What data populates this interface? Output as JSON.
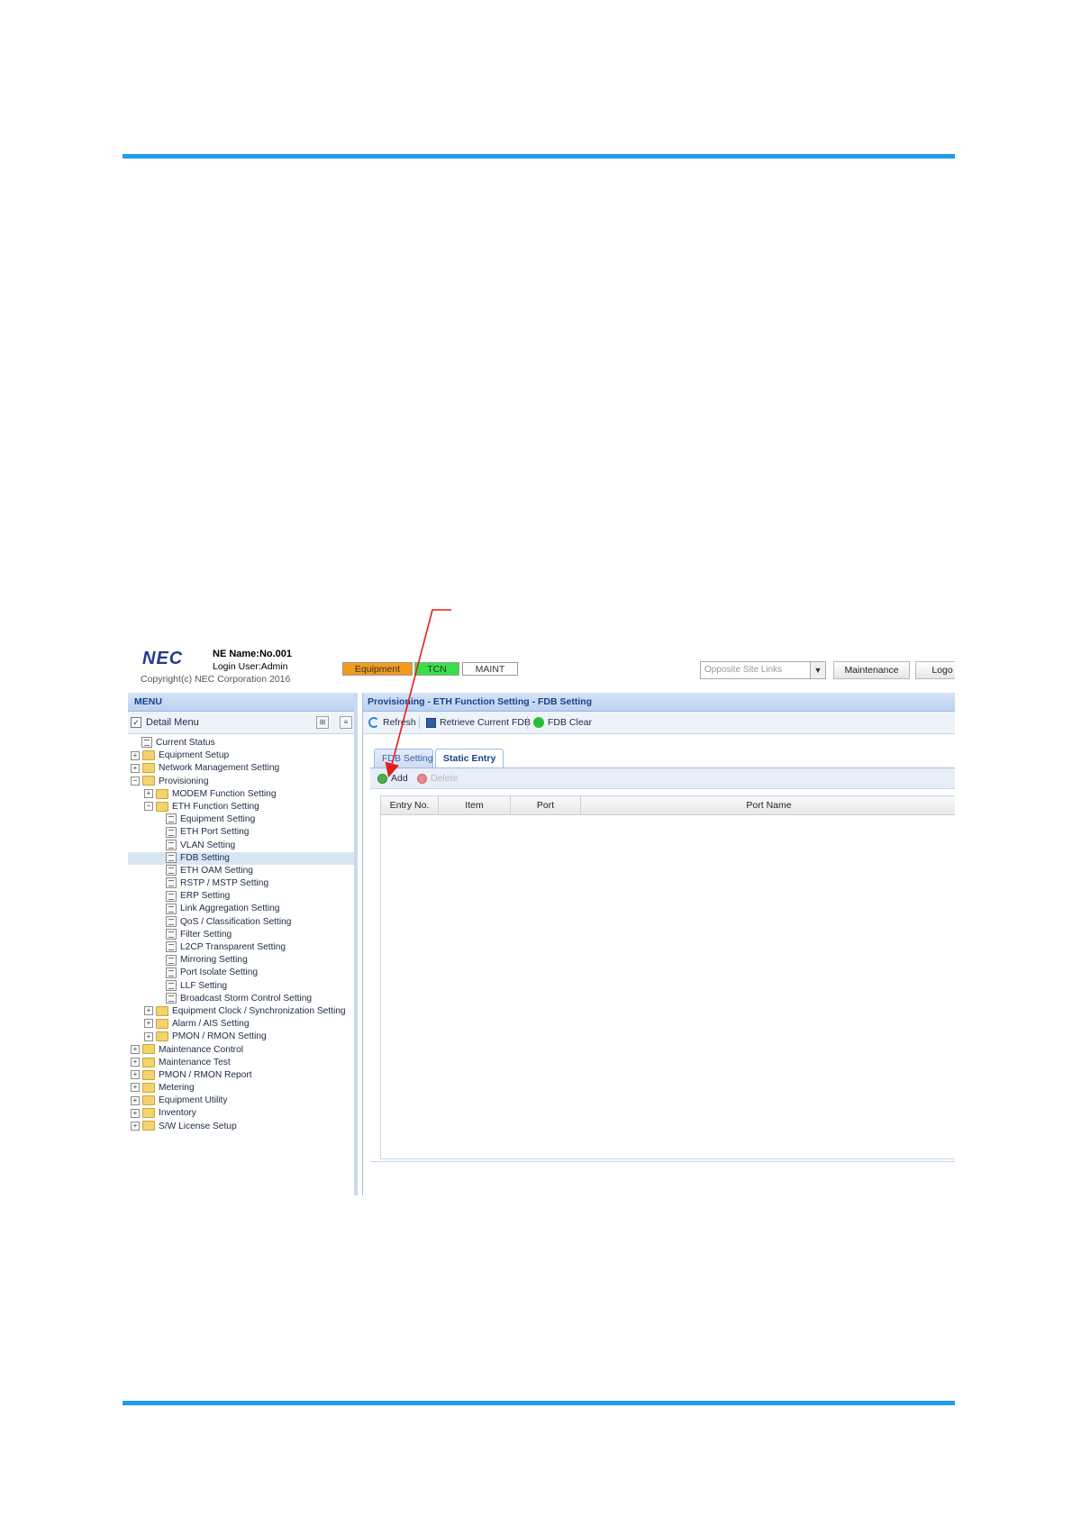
{
  "header": {
    "logo": "NEC",
    "ne_name": "NE Name:No.001",
    "login_user": "Login User:Admin",
    "copyright": "Copyright(c) NEC Corporation 2016",
    "status": {
      "equipment": "Equipment",
      "tcn": "TCN",
      "maint": "MAINT"
    },
    "site_select_placeholder": "Opposite Site Links",
    "maintenance_button": "Maintenance",
    "logout_button": "Logo"
  },
  "menu": {
    "title": "MENU",
    "detail_menu": "Detail Menu",
    "items": [
      {
        "label": "Current Status",
        "level": 0,
        "type": "leaf"
      },
      {
        "label": "Equipment Setup",
        "level": 0,
        "type": "folder",
        "expanded": false
      },
      {
        "label": "Network Management Setting",
        "level": 0,
        "type": "folder",
        "expanded": false
      },
      {
        "label": "Provisioning",
        "level": 0,
        "type": "folder",
        "expanded": true
      },
      {
        "label": "MODEM Function Setting",
        "level": 1,
        "type": "folder",
        "expanded": false
      },
      {
        "label": "ETH Function Setting",
        "level": 1,
        "type": "folder",
        "expanded": true
      },
      {
        "label": "Equipment Setting",
        "level": 2,
        "type": "leaf"
      },
      {
        "label": "ETH Port Setting",
        "level": 2,
        "type": "leaf"
      },
      {
        "label": "VLAN Setting",
        "level": 2,
        "type": "leaf"
      },
      {
        "label": "FDB Setting",
        "level": 2,
        "type": "leaf",
        "selected": true
      },
      {
        "label": "ETH OAM Setting",
        "level": 2,
        "type": "leaf"
      },
      {
        "label": "RSTP / MSTP Setting",
        "level": 2,
        "type": "leaf"
      },
      {
        "label": "ERP Setting",
        "level": 2,
        "type": "leaf"
      },
      {
        "label": "Link Aggregation Setting",
        "level": 2,
        "type": "leaf"
      },
      {
        "label": "QoS / Classification Setting",
        "level": 2,
        "type": "leaf"
      },
      {
        "label": "Filter Setting",
        "level": 2,
        "type": "leaf"
      },
      {
        "label": "L2CP Transparent Setting",
        "level": 2,
        "type": "leaf"
      },
      {
        "label": "Mirroring Setting",
        "level": 2,
        "type": "leaf"
      },
      {
        "label": "Port Isolate Setting",
        "level": 2,
        "type": "leaf"
      },
      {
        "label": "LLF Setting",
        "level": 2,
        "type": "leaf"
      },
      {
        "label": "Broadcast Storm Control Setting",
        "level": 2,
        "type": "leaf"
      },
      {
        "label": "Equipment Clock / Synchronization Setting",
        "level": 1,
        "type": "folder",
        "expanded": false
      },
      {
        "label": "Alarm / AIS Setting",
        "level": 1,
        "type": "folder",
        "expanded": false
      },
      {
        "label": "PMON / RMON Setting",
        "level": 1,
        "type": "folder",
        "expanded": false
      },
      {
        "label": "Maintenance Control",
        "level": 0,
        "type": "folder",
        "expanded": false
      },
      {
        "label": "Maintenance Test",
        "level": 0,
        "type": "folder",
        "expanded": false
      },
      {
        "label": "PMON / RMON Report",
        "level": 0,
        "type": "folder",
        "expanded": false
      },
      {
        "label": "Metering",
        "level": 0,
        "type": "folder",
        "expanded": false
      },
      {
        "label": "Equipment Utility",
        "level": 0,
        "type": "folder",
        "expanded": false
      },
      {
        "label": "Inventory",
        "level": 0,
        "type": "folder",
        "expanded": false
      },
      {
        "label": "S/W License Setup",
        "level": 0,
        "type": "folder",
        "expanded": false
      }
    ]
  },
  "content": {
    "title": "Provisioning - ETH Function Setting - FDB Setting",
    "toolbar": {
      "refresh": "Refresh",
      "retrieve": "Retrieve Current FDB",
      "fdb_clear": "FDB Clear"
    },
    "tabs": [
      {
        "label": "FDB Setting",
        "active": false
      },
      {
        "label": "Static Entry",
        "active": true
      }
    ],
    "subtoolbar": {
      "add": "Add",
      "delete": "Delete"
    },
    "columns": [
      "Entry No.",
      "Item",
      "Port",
      "Port Name"
    ]
  },
  "colors": {
    "rule": "#1e9be9",
    "equipment_status": "#f39a1c",
    "tcn_status": "#37e04a",
    "annotation_arrow": "#e02020"
  }
}
